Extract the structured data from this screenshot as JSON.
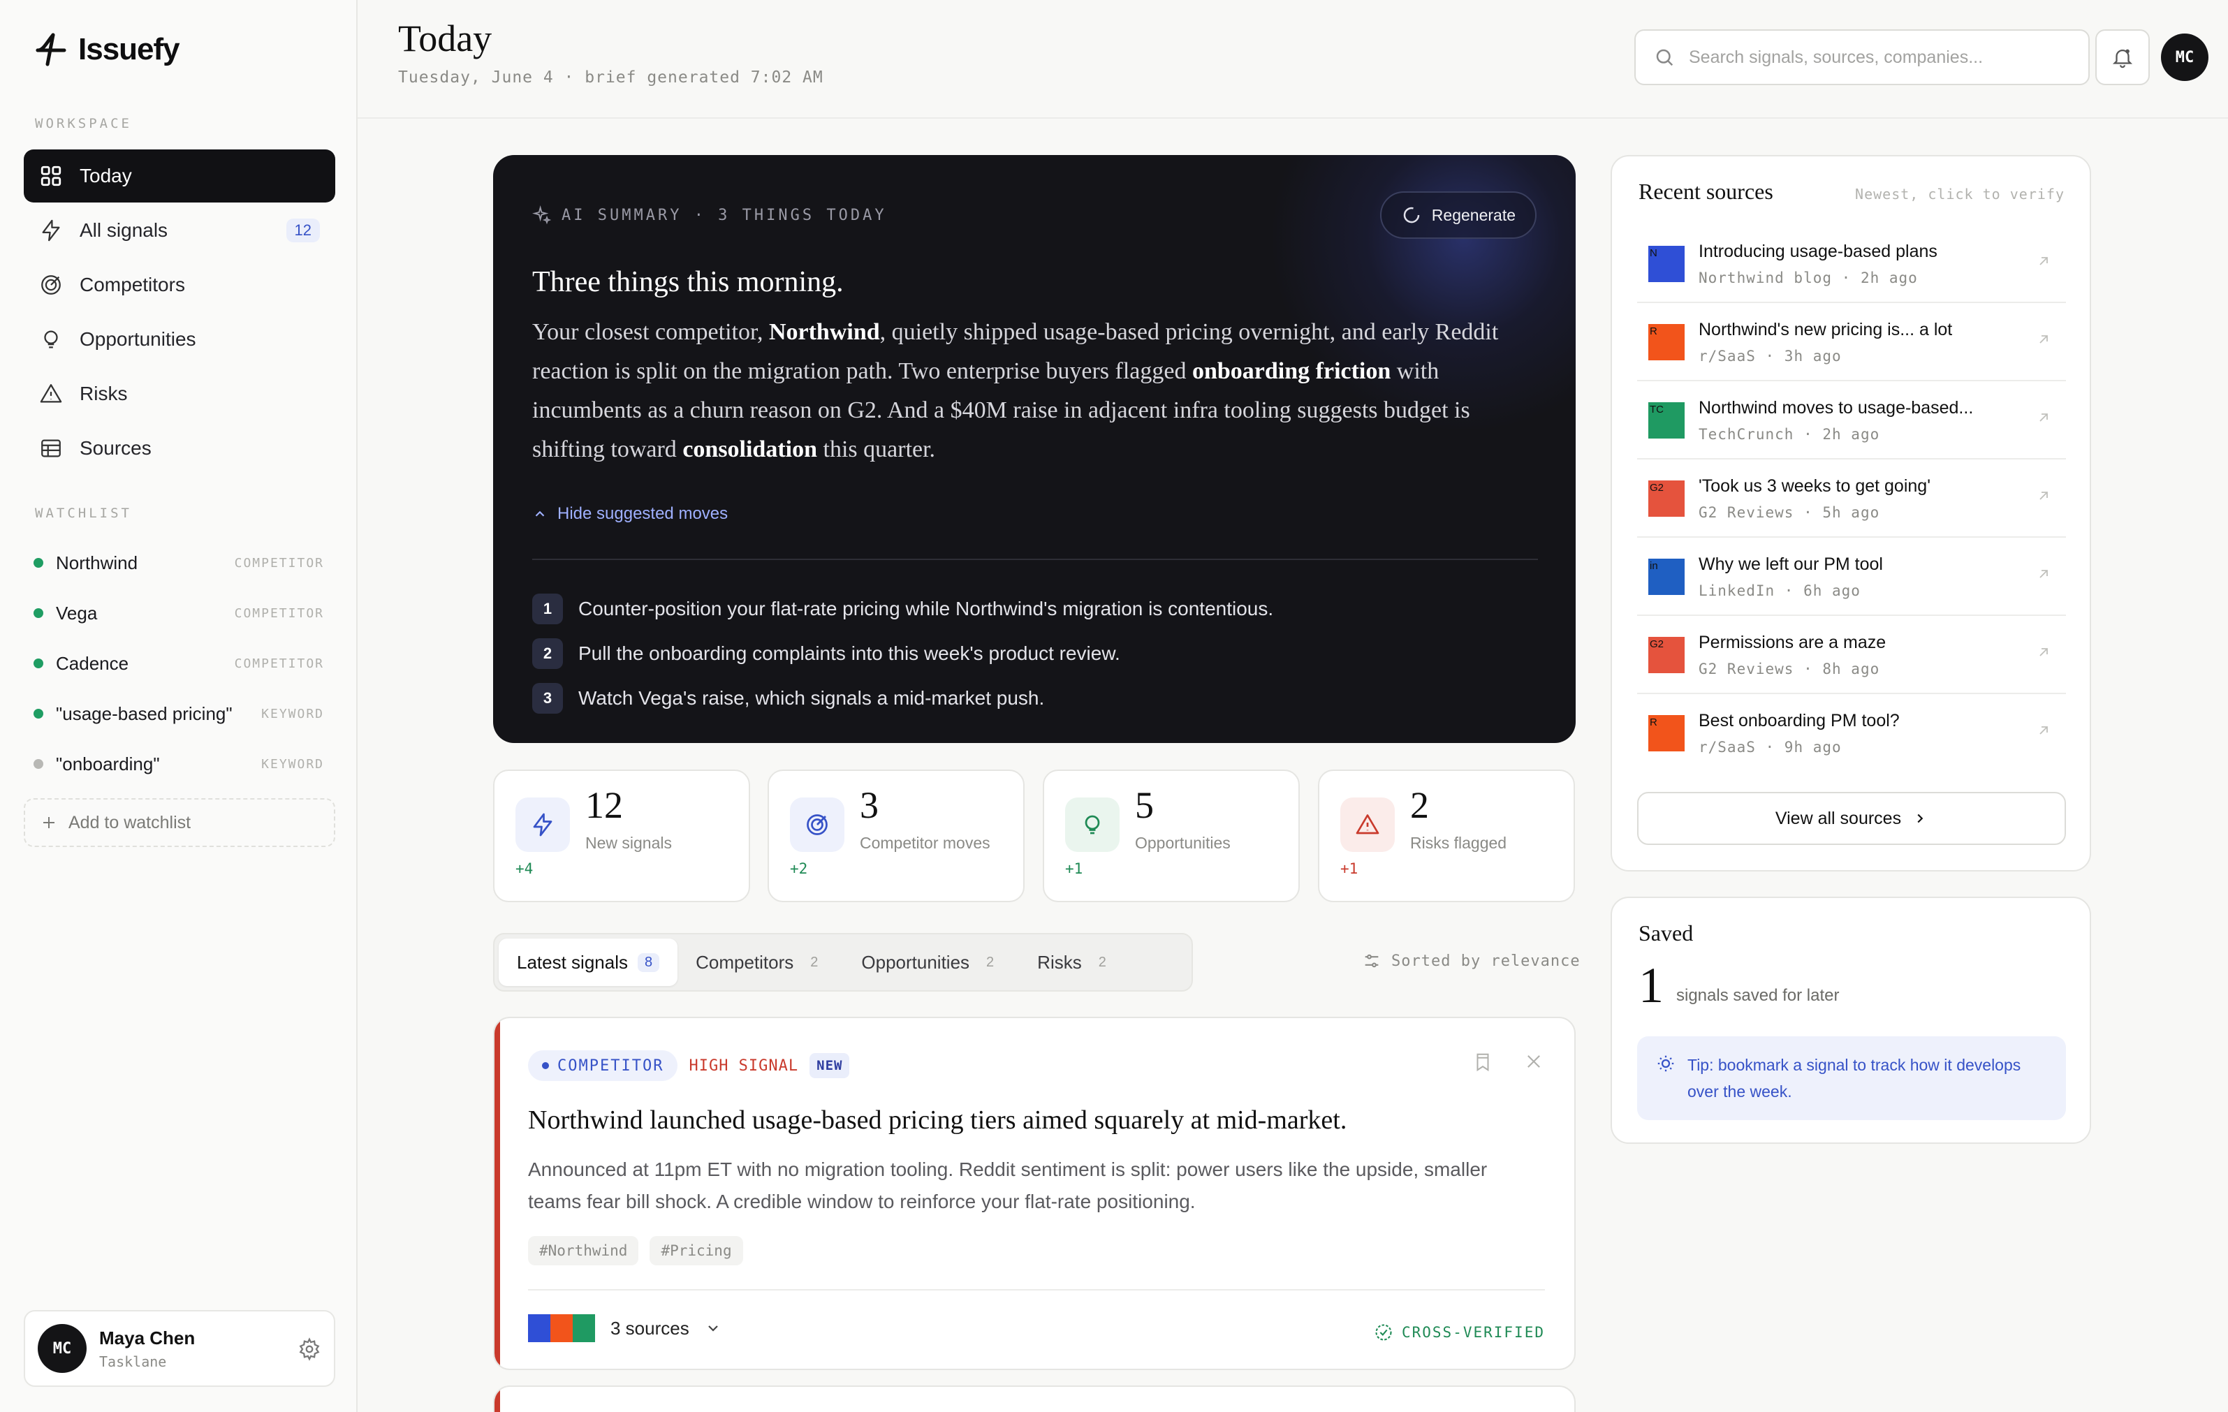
{
  "app": {
    "name": "Issuefy"
  },
  "sidebar": {
    "workspace_label": "WORKSPACE",
    "nav": [
      {
        "label": "Today",
        "icon": "grid-icon",
        "active": true
      },
      {
        "label": "All signals",
        "icon": "bolt-icon",
        "badge": "12"
      },
      {
        "label": "Competitors",
        "icon": "target-icon"
      },
      {
        "label": "Opportunities",
        "icon": "lightbulb-icon"
      },
      {
        "label": "Risks",
        "icon": "warning-icon"
      },
      {
        "label": "Sources",
        "icon": "table-icon"
      }
    ],
    "watchlist_label": "WATCHLIST",
    "watchlist": [
      {
        "name": "Northwind",
        "type": "COMPETITOR",
        "status": "active"
      },
      {
        "name": "Vega",
        "type": "COMPETITOR",
        "status": "active"
      },
      {
        "name": "Cadence",
        "type": "COMPETITOR",
        "status": "active"
      },
      {
        "name": "\"usage-based pricing\"",
        "type": "KEYWORD",
        "status": "active"
      },
      {
        "name": "\"onboarding\"",
        "type": "KEYWORD",
        "status": "inactive"
      }
    ],
    "add_watch_label": "Add to watchlist",
    "user": {
      "initials": "MC",
      "name": "Maya Chen",
      "org": "Tasklane"
    }
  },
  "header": {
    "title": "Today",
    "subtitle": "Tuesday, June 4 · brief generated 7:02 AM",
    "search_placeholder": "Search signals, sources, companies...",
    "avatar_initials": "MC"
  },
  "summary": {
    "label": "AI SUMMARY · 3 THINGS TODAY",
    "regenerate_label": "Regenerate",
    "title": "Three things this morning.",
    "body": {
      "p1": "Your closest competitor, ",
      "b1": "Northwind",
      "p2": ", quietly shipped usage-based pricing overnight, and early Reddit reaction is split on the migration path. Two enterprise buyers flagged ",
      "b2": "onboarding friction",
      "p3": " with incumbents as a churn reason on G2. And a $40M raise in adjacent infra tooling suggests budget is shifting toward ",
      "b3": "consolidation",
      "p4": " this quarter."
    },
    "toggle_label": "Hide suggested moves",
    "moves": [
      {
        "num": "1",
        "text": "Counter-position your flat-rate pricing while Northwind's migration is contentious."
      },
      {
        "num": "2",
        "text": "Pull the onboarding complaints into this week's product review."
      },
      {
        "num": "3",
        "text": "Watch Vega's raise, which signals a mid-market push."
      }
    ]
  },
  "stats": [
    {
      "value": "12",
      "label": "New signals",
      "delta": "+4",
      "icon": "bolt-icon",
      "tone": "blue"
    },
    {
      "value": "3",
      "label": "Competitor moves",
      "delta": "+2",
      "icon": "target-icon",
      "tone": "blue"
    },
    {
      "value": "5",
      "label": "Opportunities",
      "delta": "+1",
      "icon": "lightbulb-icon",
      "tone": "green"
    },
    {
      "value": "2",
      "label": "Risks flagged",
      "delta": "+1",
      "icon": "warning-icon",
      "tone": "red"
    }
  ],
  "tabs": [
    {
      "label": "Latest signals",
      "count": "8",
      "active": true
    },
    {
      "label": "Competitors",
      "count": "2"
    },
    {
      "label": "Opportunities",
      "count": "2"
    },
    {
      "label": "Risks",
      "count": "2"
    }
  ],
  "sort_label": "Sorted by relevance",
  "signal": {
    "category": "COMPETITOR",
    "strength": "HIGH SIGNAL",
    "badge": "NEW",
    "title": "Northwind launched usage-based pricing tiers aimed squarely at mid-market.",
    "body": "Announced at 11pm ET with no migration tooling. Reddit sentiment is split: power users like the upside, smaller teams fear bill shock. A credible window to reinforce your flat-rate positioning.",
    "hashtags": [
      "#Northwind",
      "#Pricing"
    ],
    "sources_label": "3 sources",
    "verified_label": "CROSS-VERIFIED"
  },
  "recent_sources": {
    "title": "Recent sources",
    "hint": "Newest, click to verify",
    "items": [
      {
        "title": "Introducing usage-based plans",
        "source": "Northwind blog",
        "age": "2h ago",
        "abbr": "N",
        "color": "#2f4fd6"
      },
      {
        "title": "Northwind's new pricing is... a lot",
        "source": "r/SaaS",
        "age": "3h ago",
        "abbr": "R",
        "color": "#f2541b"
      },
      {
        "title": "Northwind moves to usage-based...",
        "source": "TechCrunch",
        "age": "2h ago",
        "abbr": "TC",
        "color": "#1f9a62"
      },
      {
        "title": "'Took us 3 weeks to get going'",
        "source": "G2 Reviews",
        "age": "5h ago",
        "abbr": "G2",
        "color": "#e5533d"
      },
      {
        "title": "Why we left our PM tool",
        "source": "LinkedIn",
        "age": "6h ago",
        "abbr": "in",
        "color": "#1f5fc2"
      },
      {
        "title": "Permissions are a maze",
        "source": "G2 Reviews",
        "age": "8h ago",
        "abbr": "G2",
        "color": "#e5533d"
      },
      {
        "title": "Best onboarding PM tool?",
        "source": "r/SaaS",
        "age": "9h ago",
        "abbr": "R",
        "color": "#f2541b"
      }
    ],
    "view_all_label": "View all sources"
  },
  "saved": {
    "title": "Saved",
    "count": "1",
    "label": "signals saved for later",
    "tip": "Tip: bookmark a signal to track how it develops over the week."
  },
  "colors": {
    "accent": "#3652c7",
    "dark": "#141418",
    "success": "#1f8a55",
    "danger": "#c93a2c"
  }
}
